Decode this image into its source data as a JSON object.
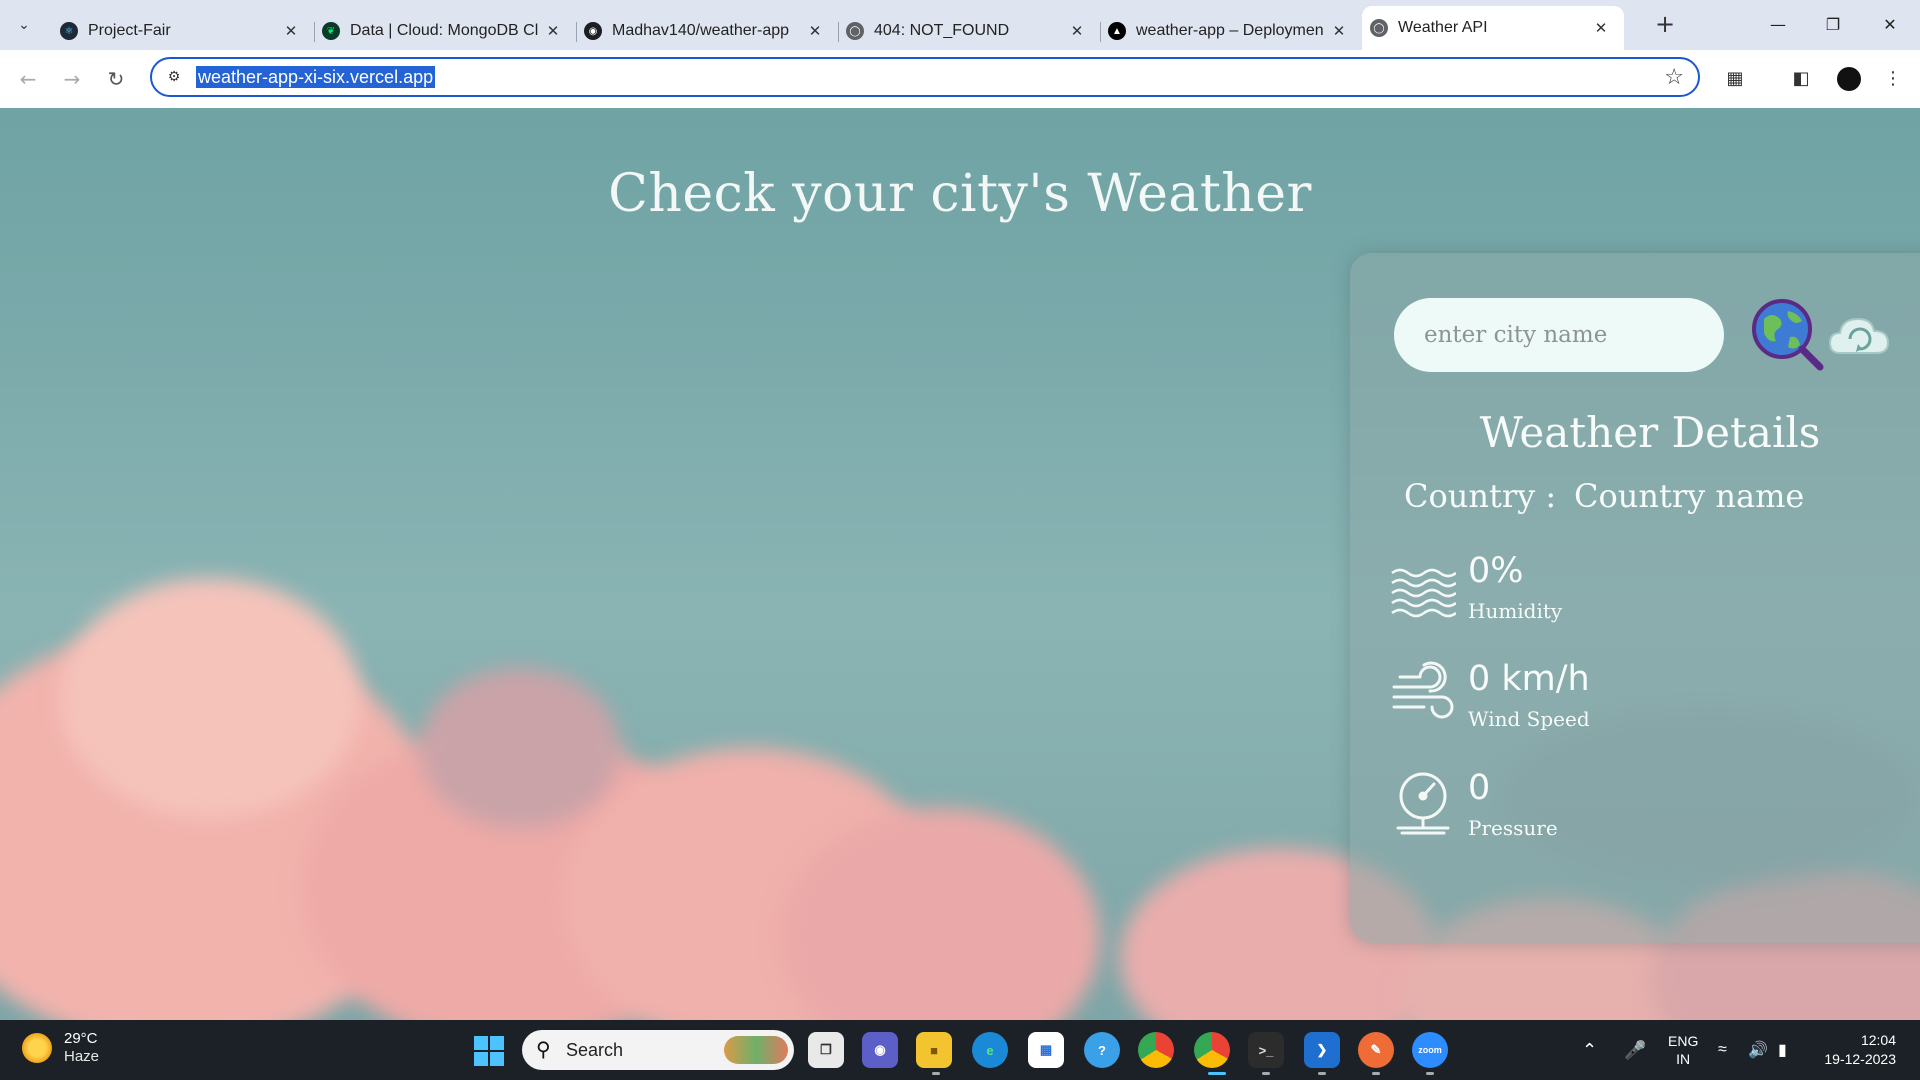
{
  "browser": {
    "tabs": [
      {
        "title": "Project-Fair",
        "favicon": "react-icon",
        "color": "#1e2a3a",
        "active": false
      },
      {
        "title": "Data | Cloud: MongoDB Cl",
        "favicon": "mongodb-leaf-icon",
        "color": "#0a3b2a",
        "active": false
      },
      {
        "title": "Madhav140/weather-app",
        "favicon": "github-icon",
        "color": "#1b1f24",
        "active": false
      },
      {
        "title": "404: NOT_FOUND",
        "favicon": "globe-icon",
        "color": "#5f6368",
        "active": false
      },
      {
        "title": "weather-app – Deploymen",
        "favicon": "vercel-icon",
        "color": "#000000",
        "active": false
      },
      {
        "title": "Weather API",
        "favicon": "globe-icon",
        "color": "#5f6368",
        "active": true
      }
    ],
    "url": "weather-app-xi-six.vercel.app"
  },
  "page": {
    "title": "Check your city's Weather",
    "search": {
      "placeholder": "enter city name",
      "value": ""
    },
    "details_title": "Weather Details",
    "country_label": "Country :",
    "country_value": "Country name",
    "metrics": [
      {
        "value": "0%",
        "label": "Humidity",
        "icon": "humidity-waves-icon"
      },
      {
        "value": "0 km/h",
        "label": "Wind Speed",
        "icon": "wind-icon"
      },
      {
        "value": "0",
        "label": "Pressure",
        "icon": "pressure-gauge-icon"
      }
    ]
  },
  "taskbar": {
    "weather": {
      "temp": "29°C",
      "condition": "Haze"
    },
    "search_label": "Search",
    "language": {
      "line1": "ENG",
      "line2": "IN"
    },
    "time": "12:04",
    "date": "19-12-2023"
  },
  "colors": {
    "accent_blue": "#1a57d2",
    "page_teal": "#7dabac",
    "cloud_pink": "#f2b3ad",
    "taskbar": "#1c2128"
  }
}
